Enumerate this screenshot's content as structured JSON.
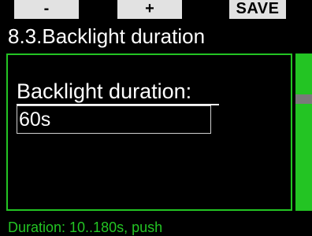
{
  "softkeys": {
    "minus_label": "-",
    "plus_label": "+",
    "save_label": "SAVE"
  },
  "screen": {
    "title": "8.3.Backlight duration"
  },
  "field": {
    "label": "Backlight duration:",
    "value": "60s"
  },
  "help": {
    "text": "Duration: 10..180s, push"
  },
  "colors": {
    "accent": "#23c423",
    "softkey_bg": "#e2e2e2",
    "scroll_thumb": "#7a7a7a"
  }
}
